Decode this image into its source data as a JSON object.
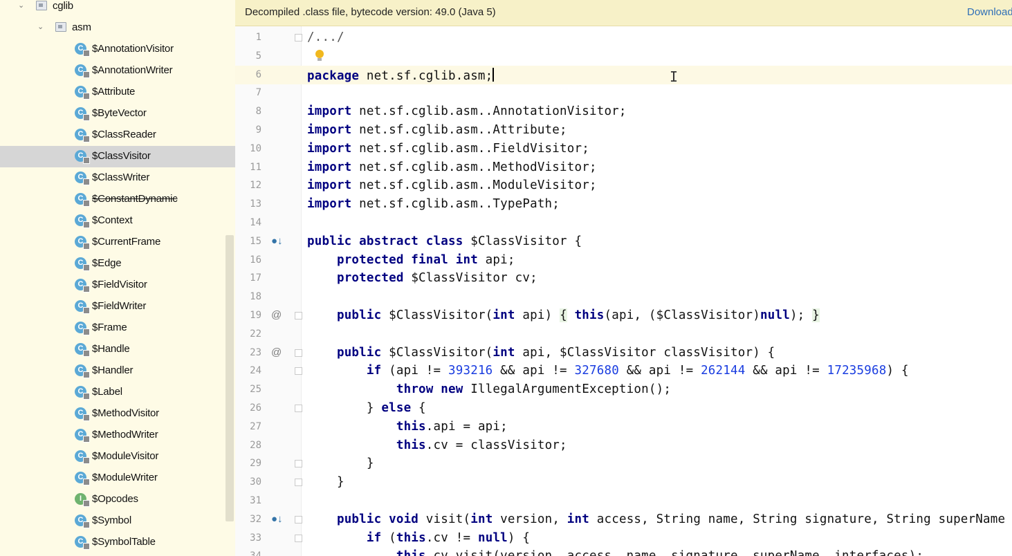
{
  "sidebar": {
    "items": [
      {
        "label": "cglib",
        "kind": "package",
        "expanded": true
      },
      {
        "label": "asm",
        "kind": "package",
        "expanded": true
      },
      {
        "label": "$AnnotationVisitor",
        "kind": "class"
      },
      {
        "label": "$AnnotationWriter",
        "kind": "class"
      },
      {
        "label": "$Attribute",
        "kind": "class"
      },
      {
        "label": "$ByteVector",
        "kind": "class"
      },
      {
        "label": "$ClassReader",
        "kind": "class"
      },
      {
        "label": "$ClassVisitor",
        "kind": "class",
        "selected": true
      },
      {
        "label": "$ClassWriter",
        "kind": "class"
      },
      {
        "label": "$ConstantDynamic",
        "kind": "class",
        "deprecated": true
      },
      {
        "label": "$Context",
        "kind": "class"
      },
      {
        "label": "$CurrentFrame",
        "kind": "class"
      },
      {
        "label": "$Edge",
        "kind": "class"
      },
      {
        "label": "$FieldVisitor",
        "kind": "class"
      },
      {
        "label": "$FieldWriter",
        "kind": "class"
      },
      {
        "label": "$Frame",
        "kind": "class"
      },
      {
        "label": "$Handle",
        "kind": "class"
      },
      {
        "label": "$Handler",
        "kind": "class"
      },
      {
        "label": "$Label",
        "kind": "class"
      },
      {
        "label": "$MethodVisitor",
        "kind": "class"
      },
      {
        "label": "$MethodWriter",
        "kind": "class"
      },
      {
        "label": "$ModuleVisitor",
        "kind": "class"
      },
      {
        "label": "$ModuleWriter",
        "kind": "class"
      },
      {
        "label": "$Opcodes",
        "kind": "interface"
      },
      {
        "label": "$Symbol",
        "kind": "class"
      },
      {
        "label": "$SymbolTable",
        "kind": "class"
      }
    ]
  },
  "banner": {
    "message": "Decompiled .class file, bytecode version: 49.0 (Java 5)",
    "link": "Download"
  },
  "editor": {
    "current_line": "6",
    "lines": [
      {
        "n": "1",
        "fold": true,
        "tokens": [
          [
            "cmt",
            "/.../"
          ]
        ]
      },
      {
        "n": "5",
        "bulb": true,
        "tokens": []
      },
      {
        "n": "6",
        "caret": true,
        "tokens": [
          [
            "kw",
            "package"
          ],
          [
            "txt",
            " net.sf.cglib.asm;"
          ]
        ]
      },
      {
        "n": "7",
        "tokens": []
      },
      {
        "n": "8",
        "tokens": [
          [
            "kw",
            "import"
          ],
          [
            "txt",
            " net.sf.cglib.asm..AnnotationVisitor;"
          ]
        ]
      },
      {
        "n": "9",
        "tokens": [
          [
            "kw",
            "import"
          ],
          [
            "txt",
            " net.sf.cglib.asm..Attribute;"
          ]
        ]
      },
      {
        "n": "10",
        "tokens": [
          [
            "kw",
            "import"
          ],
          [
            "txt",
            " net.sf.cglib.asm..FieldVisitor;"
          ]
        ]
      },
      {
        "n": "11",
        "tokens": [
          [
            "kw",
            "import"
          ],
          [
            "txt",
            " net.sf.cglib.asm..MethodVisitor;"
          ]
        ]
      },
      {
        "n": "12",
        "tokens": [
          [
            "kw",
            "import"
          ],
          [
            "txt",
            " net.sf.cglib.asm..ModuleVisitor;"
          ]
        ]
      },
      {
        "n": "13",
        "tokens": [
          [
            "kw",
            "import"
          ],
          [
            "txt",
            " net.sf.cglib.asm..TypePath;"
          ]
        ]
      },
      {
        "n": "14",
        "tokens": []
      },
      {
        "n": "15",
        "gicon": "implemented",
        "tokens": [
          [
            "kw",
            "public abstract class"
          ],
          [
            "txt",
            " $ClassVisitor {"
          ]
        ]
      },
      {
        "n": "16",
        "tokens": [
          [
            "txt",
            "    "
          ],
          [
            "kw",
            "protected final int"
          ],
          [
            "txt",
            " api;"
          ]
        ]
      },
      {
        "n": "17",
        "tokens": [
          [
            "txt",
            "    "
          ],
          [
            "kw",
            "protected"
          ],
          [
            "txt",
            " $ClassVisitor cv;"
          ]
        ]
      },
      {
        "n": "18",
        "tokens": []
      },
      {
        "n": "19",
        "gicon": "at",
        "fold": true,
        "tokens": [
          [
            "txt",
            "    "
          ],
          [
            "kw",
            "public"
          ],
          [
            "txt",
            " $ClassVisitor("
          ],
          [
            "kw",
            "int"
          ],
          [
            "txt",
            " api) "
          ],
          [
            "hl",
            "{"
          ],
          [
            "txt",
            " "
          ],
          [
            "kw",
            "this"
          ],
          [
            "txt",
            "(api, ($ClassVisitor)"
          ],
          [
            "kw",
            "null"
          ],
          [
            "txt",
            "); "
          ],
          [
            "hl",
            "}"
          ]
        ]
      },
      {
        "n": "22",
        "tokens": []
      },
      {
        "n": "23",
        "gicon": "at",
        "fold": true,
        "tokens": [
          [
            "txt",
            "    "
          ],
          [
            "kw",
            "public"
          ],
          [
            "txt",
            " $ClassVisitor("
          ],
          [
            "kw",
            "int"
          ],
          [
            "txt",
            " api, $ClassVisitor classVisitor) {"
          ]
        ]
      },
      {
        "n": "24",
        "fold": true,
        "tokens": [
          [
            "txt",
            "        "
          ],
          [
            "kw",
            "if"
          ],
          [
            "txt",
            " (api != "
          ],
          [
            "num",
            "393216"
          ],
          [
            "txt",
            " && api != "
          ],
          [
            "num",
            "327680"
          ],
          [
            "txt",
            " && api != "
          ],
          [
            "num",
            "262144"
          ],
          [
            "txt",
            " && api != "
          ],
          [
            "num",
            "17235968"
          ],
          [
            "txt",
            ") {"
          ]
        ]
      },
      {
        "n": "25",
        "tokens": [
          [
            "txt",
            "            "
          ],
          [
            "kw",
            "throw new"
          ],
          [
            "txt",
            " IllegalArgumentException();"
          ]
        ]
      },
      {
        "n": "26",
        "fold": true,
        "tokens": [
          [
            "txt",
            "        } "
          ],
          [
            "kw",
            "else"
          ],
          [
            "txt",
            " {"
          ]
        ]
      },
      {
        "n": "27",
        "tokens": [
          [
            "txt",
            "            "
          ],
          [
            "kw",
            "this"
          ],
          [
            "txt",
            ".api = api;"
          ]
        ]
      },
      {
        "n": "28",
        "tokens": [
          [
            "txt",
            "            "
          ],
          [
            "kw",
            "this"
          ],
          [
            "txt",
            ".cv = classVisitor;"
          ]
        ]
      },
      {
        "n": "29",
        "fold": true,
        "tokens": [
          [
            "txt",
            "        }"
          ]
        ]
      },
      {
        "n": "30",
        "fold": true,
        "tokens": [
          [
            "txt",
            "    }"
          ]
        ]
      },
      {
        "n": "31",
        "tokens": []
      },
      {
        "n": "32",
        "gicon": "implemented",
        "fold": true,
        "tokens": [
          [
            "txt",
            "    "
          ],
          [
            "kw",
            "public void"
          ],
          [
            "txt",
            " visit("
          ],
          [
            "kw",
            "int"
          ],
          [
            "txt",
            " version, "
          ],
          [
            "kw",
            "int"
          ],
          [
            "txt",
            " access, String name, String signature, String superName"
          ]
        ]
      },
      {
        "n": "33",
        "fold": true,
        "tokens": [
          [
            "txt",
            "        "
          ],
          [
            "kw",
            "if"
          ],
          [
            "txt",
            " ("
          ],
          [
            "kw",
            "this"
          ],
          [
            "txt",
            ".cv != "
          ],
          [
            "kw",
            "null"
          ],
          [
            "txt",
            ") {"
          ]
        ]
      },
      {
        "n": "34",
        "tokens": [
          [
            "txt",
            "            "
          ],
          [
            "kw",
            "this"
          ],
          [
            "txt",
            ".cv.visit(version, access, name, signature, superName, interfaces);"
          ]
        ]
      }
    ]
  }
}
